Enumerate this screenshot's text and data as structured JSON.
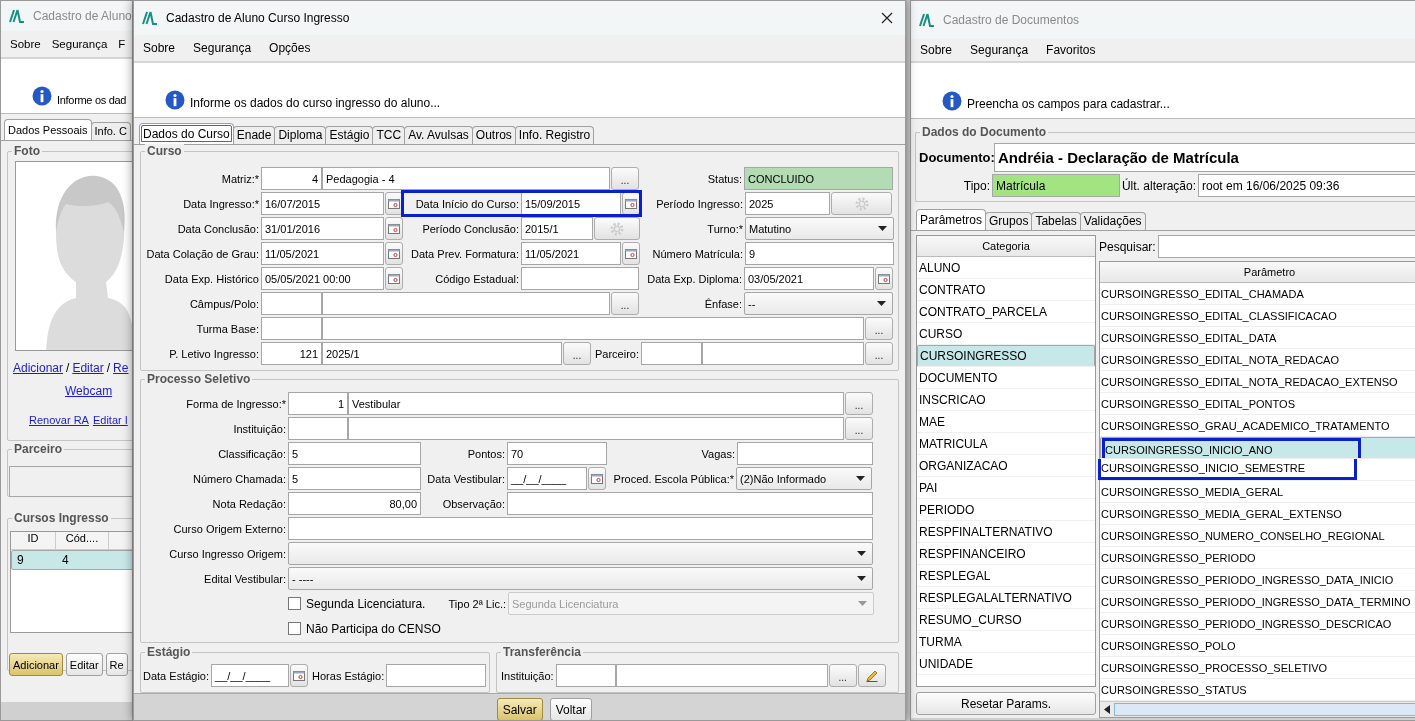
{
  "left_window": {
    "title": "Cadastro de Aluno",
    "menu": [
      "Sobre",
      "Segurança",
      "F"
    ],
    "info": "Informe os dad",
    "tabs": [
      {
        "label": "Dados Pessoais",
        "selected": true
      },
      {
        "label": "Info. C",
        "selected": false
      }
    ],
    "foto_title": "Foto",
    "photo_actions": [
      {
        "kind": "link",
        "label": "Adicionar"
      },
      {
        "kind": "separator",
        "label": "/"
      },
      {
        "kind": "link",
        "label": "Editar"
      },
      {
        "kind": "separator",
        "label": "/"
      },
      {
        "kind": "link",
        "label": "Re"
      }
    ],
    "webcam": "Webcam",
    "bottom_links": [
      "Renovar RA",
      "Editar I"
    ],
    "parceiro_title": "Parceiro",
    "cursos_title": "Cursos Ingresso",
    "table": {
      "columns": [
        "ID",
        "Cód...."
      ],
      "rows": [
        {
          "cells": [
            "9",
            "4"
          ],
          "selected": true
        }
      ]
    },
    "buttons": [
      {
        "label": "Adicionar",
        "default": true
      },
      {
        "label": "Editar",
        "default": false
      },
      {
        "label": "Re",
        "default": false
      }
    ]
  },
  "dialog": {
    "title": "Cadastro de Aluno Curso Ingresso",
    "menu": [
      "Sobre",
      "Segurança",
      "Opções"
    ],
    "info": "Informe os dados do curso ingresso do aluno...",
    "tabs": [
      {
        "label": "Dados do Curso",
        "selected": true
      },
      {
        "label": "Enade",
        "selected": false
      },
      {
        "label": "Diploma",
        "selected": false
      },
      {
        "label": "Estágio",
        "selected": false
      },
      {
        "label": "TCC",
        "selected": false
      },
      {
        "label": "Av. Avulsas",
        "selected": false
      },
      {
        "label": "Outros",
        "selected": false
      },
      {
        "label": "Info. Registro",
        "selected": false
      }
    ],
    "curso": {
      "title": "Curso",
      "matriz": {
        "label": "Matriz:*",
        "code": "4",
        "name": "Pedagogia - 4",
        "button": "..."
      },
      "status": {
        "label": "Status:",
        "value": "CONCLUIDO"
      },
      "data_ingresso": {
        "label": "Data Ingresso:*",
        "value": "16/07/2015"
      },
      "data_inicio": {
        "label": "Data Início do Curso:",
        "value": "15/09/2015",
        "highlighted": true
      },
      "periodo_ingresso": {
        "label": "Período Ingresso:",
        "value": "2025"
      },
      "data_conclusao": {
        "label": "Data Conclusão:",
        "value": "31/01/2016"
      },
      "periodo_conclusao": {
        "label": "Período Conclusão:",
        "value": "2015/1"
      },
      "turno": {
        "label": "Turno:*",
        "value": "Matutino"
      },
      "data_colacao": {
        "label": "Data Colação de Grau:",
        "value": "11/05/2021"
      },
      "data_prev_formatura": {
        "label": "Data Prev. Formatura:",
        "value": "11/05/2021"
      },
      "numero_matricula": {
        "label": "Número Matrícula:",
        "value": "9"
      },
      "data_exp_historico": {
        "label": "Data Exp. Histórico",
        "value": "05/05/2021 00:00"
      },
      "codigo_estadual": {
        "label": "Código Estadual:"
      },
      "data_exp_diploma": {
        "label": "Data Exp. Diploma:",
        "value": "03/05/2021"
      },
      "campus": {
        "label": "Câmpus/Polo:",
        "button": "..."
      },
      "enfase": {
        "label": "Ênfase:",
        "value": "--"
      },
      "turma_base": {
        "label": "Turma Base:",
        "button": "..."
      },
      "p_letivo": {
        "label": "P. Letivo Ingresso:",
        "code": "121",
        "name": "2025/1",
        "button": "..."
      },
      "parceiro": {
        "label": "Parceiro:",
        "button": "..."
      }
    },
    "processo": {
      "title": "Processo Seletivo",
      "forma": {
        "label": "Forma de Ingresso:*",
        "code": "1",
        "name": "Vestibular",
        "button": "..."
      },
      "instituicao": {
        "label": "Instituição:",
        "button": "..."
      },
      "classificacao": {
        "label": "Classificação:",
        "value": "5"
      },
      "pontos": {
        "label": "Pontos:",
        "value": "70"
      },
      "vagas": {
        "label": "Vagas:"
      },
      "numero_chamada": {
        "label": "Número Chamada:",
        "value": "5"
      },
      "data_vestibular": {
        "label": "Data Vestibular:",
        "value": "__/__/____"
      },
      "proced": {
        "label": "Proced. Escola Pública:*",
        "value": "(2)Não Informado"
      },
      "nota_redacao": {
        "label": "Nota Redação:",
        "value": "80,00"
      },
      "observacao": {
        "label": "Observação:"
      },
      "curso_origem_externo": {
        "label": "Curso Origem Externo:"
      },
      "curso_ingresso_origem": {
        "label": "Curso Ingresso Origem:"
      },
      "edital": {
        "label": "Edital Vestibular:",
        "value": "- ----"
      },
      "segunda_lic": {
        "label": "Segunda Licenciatura.",
        "checked": false
      },
      "tipo_lic": {
        "label": "Tipo 2ª Lic.:",
        "value": "Segunda Licenciatura",
        "disabled": true
      },
      "censo": {
        "label": "Não Participa do CENSO",
        "checked": false
      }
    },
    "estagio": {
      "title": "Estágio",
      "data": {
        "label": "Data Estágio:",
        "value": "__/__/____"
      },
      "horas": {
        "label": "Horas Estágio:"
      }
    },
    "transferencia": {
      "title": "Transferência",
      "instituicao": {
        "label": "Instituição:",
        "button": "..."
      }
    },
    "buttons": [
      {
        "label": "Salvar",
        "default": true
      },
      {
        "label": "Voltar",
        "default": false
      }
    ]
  },
  "documents": {
    "title": "Cadastro de Documentos",
    "menu": [
      "Sobre",
      "Segurança",
      "Favoritos"
    ],
    "info": "Preencha os campos para cadastrar...",
    "section": "Dados do Documento",
    "documento": {
      "label": "Documento:",
      "value": "Andréia - Declaração de Matrícula"
    },
    "tipo": {
      "label": "Tipo:",
      "value": "Matrícula"
    },
    "ultima": {
      "label": "Últ. alteração:",
      "value": "root em 16/06/2025 09:36"
    },
    "tabs": [
      {
        "label": "Parâmetros",
        "selected": true
      },
      {
        "label": "Grupos",
        "selected": false
      },
      {
        "label": "Tabelas",
        "selected": false
      },
      {
        "label": "Validações",
        "selected": false
      }
    ],
    "categories": {
      "column": "Categoria",
      "items": [
        {
          "label": "ALUNO",
          "selected": false
        },
        {
          "label": "CONTRATO",
          "selected": false
        },
        {
          "label": "CONTRATO_PARCELA",
          "selected": false
        },
        {
          "label": "CURSO",
          "selected": false
        },
        {
          "label": "CURSOINGRESSO",
          "selected": true
        },
        {
          "label": "DOCUMENTO",
          "selected": false
        },
        {
          "label": "INSCRICAO",
          "selected": false
        },
        {
          "label": "MAE",
          "selected": false
        },
        {
          "label": "MATRICULA",
          "selected": false
        },
        {
          "label": "ORGANIZACAO",
          "selected": false
        },
        {
          "label": "PAI",
          "selected": false
        },
        {
          "label": "PERIODO",
          "selected": false
        },
        {
          "label": "RESPFINALTERNATIVO",
          "selected": false
        },
        {
          "label": "RESPFINANCEIRO",
          "selected": false
        },
        {
          "label": "RESPLEGAL",
          "selected": false
        },
        {
          "label": "RESPLEGALALTERNATIVO",
          "selected": false
        },
        {
          "label": "RESUMO_CURSO",
          "selected": false
        },
        {
          "label": "TURMA",
          "selected": false
        },
        {
          "label": "UNIDADE",
          "selected": false
        }
      ]
    },
    "reset": "Resetar Params.",
    "search_label": "Pesquisar:",
    "parameters": {
      "column": "Parâmetro",
      "rows": [
        {
          "label": "CURSOINGRESSO_EDITAL_CHAMADA",
          "selected": false,
          "highlighted": false
        },
        {
          "label": "CURSOINGRESSO_EDITAL_CLASSIFICACAO",
          "selected": false,
          "highlighted": false
        },
        {
          "label": "CURSOINGRESSO_EDITAL_DATA",
          "selected": false,
          "highlighted": false
        },
        {
          "label": "CURSOINGRESSO_EDITAL_NOTA_REDACAO",
          "selected": false,
          "highlighted": false
        },
        {
          "label": "CURSOINGRESSO_EDITAL_NOTA_REDACAO_EXTENSO",
          "selected": false,
          "highlighted": false
        },
        {
          "label": "CURSOINGRESSO_EDITAL_PONTOS",
          "selected": false,
          "highlighted": false
        },
        {
          "label": "CURSOINGRESSO_GRAU_ACADEMICO_TRATAMENTO",
          "selected": false,
          "highlighted": false
        },
        {
          "label": "CURSOINGRESSO_INICIO_ANO",
          "selected": true,
          "highlighted": true
        },
        {
          "label": "CURSOINGRESSO_INICIO_SEMESTRE",
          "selected": false,
          "highlighted": true
        },
        {
          "label": "CURSOINGRESSO_MEDIA_GERAL",
          "selected": false,
          "highlighted": false
        },
        {
          "label": "CURSOINGRESSO_MEDIA_GERAL_EXTENSO",
          "selected": false,
          "highlighted": false
        },
        {
          "label": "CURSOINGRESSO_NUMERO_CONSELHO_REGIONAL",
          "selected": false,
          "highlighted": false
        },
        {
          "label": "CURSOINGRESSO_PERIODO",
          "selected": false,
          "highlighted": false
        },
        {
          "label": "CURSOINGRESSO_PERIODO_INGRESSO_DATA_INICIO",
          "selected": false,
          "highlighted": false
        },
        {
          "label": "CURSOINGRESSO_PERIODO_INGRESSO_DATA_TERMINO",
          "selected": false,
          "highlighted": false
        },
        {
          "label": "CURSOINGRESSO_PERIODO_INGRESSO_DESCRICAO",
          "selected": false,
          "highlighted": false
        },
        {
          "label": "CURSOINGRESSO_POLO",
          "selected": false,
          "highlighted": false
        },
        {
          "label": "CURSOINGRESSO_PROCESSO_SELETIVO",
          "selected": false,
          "highlighted": false
        },
        {
          "label": "CURSOINGRESSO_STATUS",
          "selected": false,
          "highlighted": false
        }
      ]
    }
  }
}
